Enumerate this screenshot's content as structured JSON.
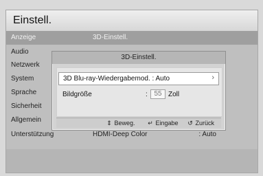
{
  "screen": {
    "title": "Einstell."
  },
  "menu": {
    "items": [
      {
        "label": "Anzeige",
        "value": "3D-Einstell.",
        "right": ""
      },
      {
        "label": "Audio",
        "value": "",
        "right": ""
      },
      {
        "label": "Netzwerk",
        "value": "",
        "right": ""
      },
      {
        "label": "System",
        "value": "",
        "right": ""
      },
      {
        "label": "Sprache",
        "value": "",
        "right": ""
      },
      {
        "label": "Sicherheit",
        "value": "",
        "right": ""
      },
      {
        "label": "Allgemein",
        "value": "",
        "right": ""
      },
      {
        "label": "Unterstützung",
        "value": "HDMI-Deep Color",
        "right": ": Auto"
      }
    ]
  },
  "dialog": {
    "title": "3D-Einstell.",
    "rows": {
      "bluray_mode": "3D Blu-ray-Wiedergabemod. : Auto",
      "size_label": "Bildgröße",
      "size_value": "55",
      "size_unit": "Zoll"
    },
    "footer": {
      "move_label": "Beweg.",
      "enter_label": "Eingabe",
      "back_label": "Zurück"
    }
  },
  "icons": {
    "move": "up-down-arrows-icon",
    "enter": "enter-icon",
    "back": "back-icon",
    "chevron": "chevron-right-icon"
  },
  "colors": {
    "highlight": "#9f9f9f",
    "dialog_bg": "#d3d3d3"
  }
}
